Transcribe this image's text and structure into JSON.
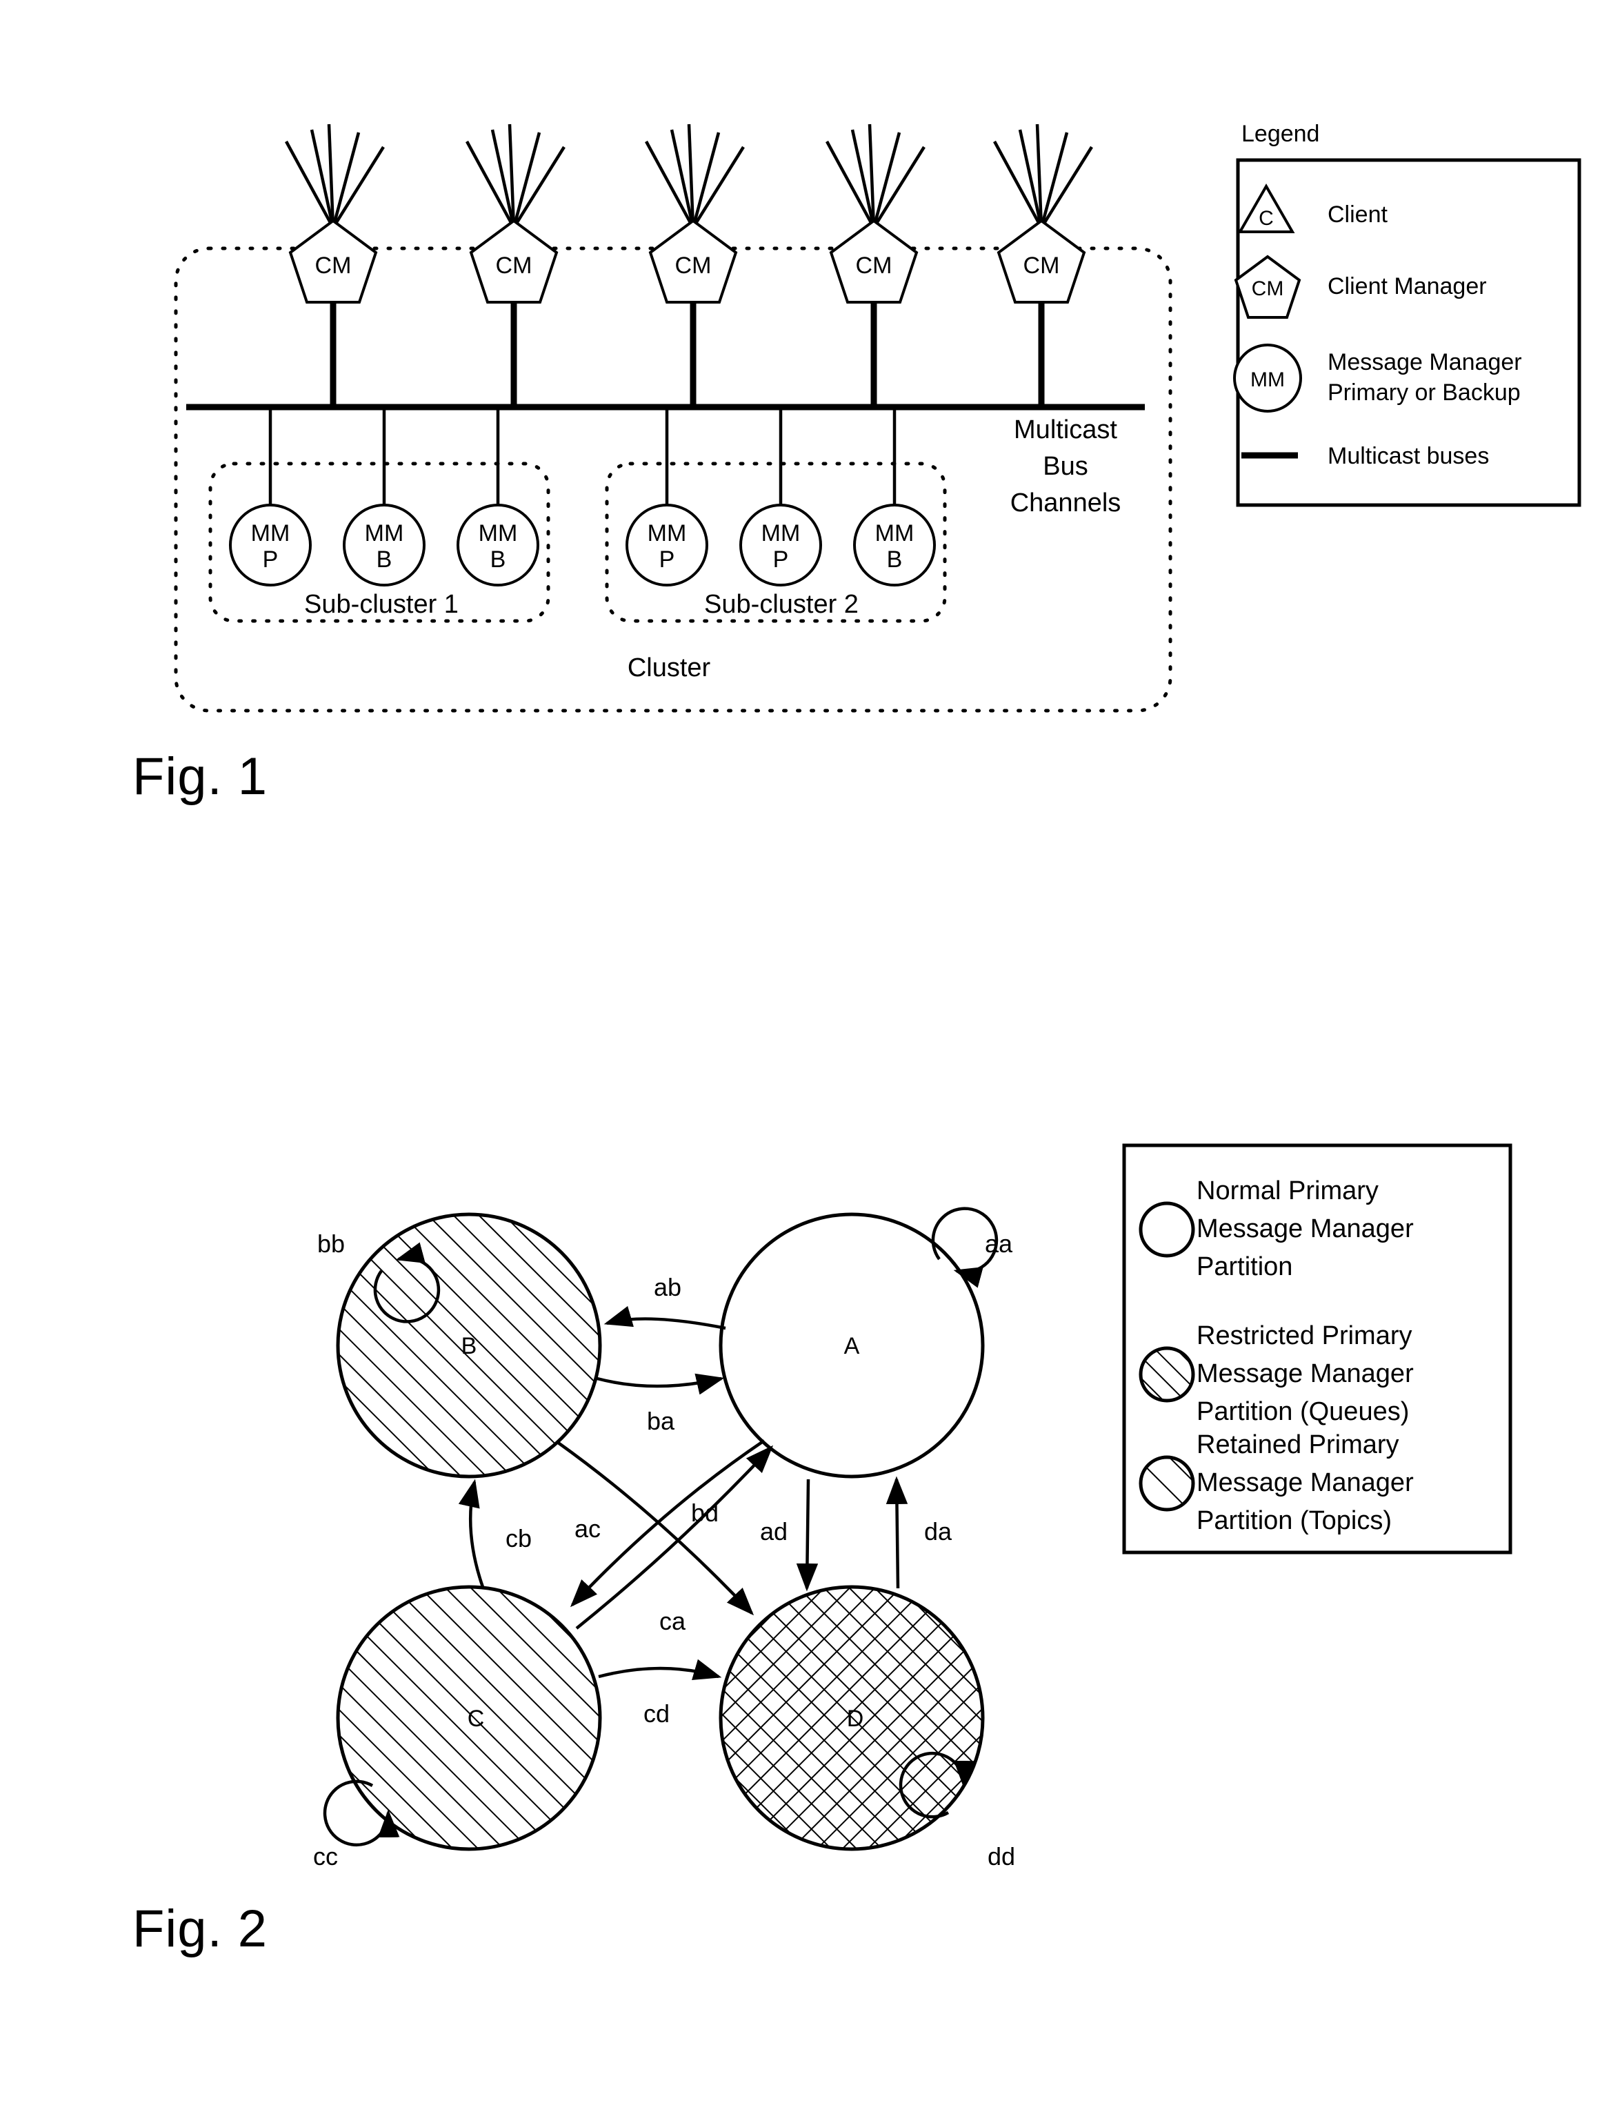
{
  "figure1": {
    "caption": "Fig. 1",
    "client_managers": [
      {
        "label": "CM"
      },
      {
        "label": "CM"
      },
      {
        "label": "CM"
      },
      {
        "label": "CM"
      },
      {
        "label": "CM"
      }
    ],
    "bus_label": [
      "Multicast",
      "Bus",
      "Channels"
    ],
    "cluster_label": "Cluster",
    "subclusters": [
      {
        "label": "Sub-cluster 1",
        "message_managers": [
          {
            "top": "MM",
            "bottom": "P"
          },
          {
            "top": "MM",
            "bottom": "B"
          },
          {
            "top": "MM",
            "bottom": "B"
          }
        ]
      },
      {
        "label": "Sub-cluster 2",
        "message_managers": [
          {
            "top": "MM",
            "bottom": "P"
          },
          {
            "top": "MM",
            "bottom": "P"
          },
          {
            "top": "MM",
            "bottom": "B"
          }
        ]
      }
    ],
    "legend": {
      "title": "Legend",
      "entries": [
        {
          "icon": "triangle",
          "icon_label": "C",
          "text": [
            "Client"
          ]
        },
        {
          "icon": "pentagon",
          "icon_label": "CM",
          "text": [
            "Client Manager"
          ]
        },
        {
          "icon": "circle",
          "icon_label": "MM",
          "text": [
            "Message Manager",
            "Primary or Backup"
          ]
        },
        {
          "icon": "line",
          "icon_label": "",
          "text": [
            "Multicast buses"
          ]
        }
      ]
    }
  },
  "figure2": {
    "caption": "Fig. 2",
    "nodes": [
      {
        "id": "A",
        "label": "A",
        "fill": "normal"
      },
      {
        "id": "B",
        "label": "B",
        "fill": "hatched"
      },
      {
        "id": "C",
        "label": "C",
        "fill": "hatched"
      },
      {
        "id": "D",
        "label": "D",
        "fill": "crosshatched"
      }
    ],
    "self_loops": [
      {
        "label": "aa",
        "node": "A"
      },
      {
        "label": "bb",
        "node": "B"
      },
      {
        "label": "cc",
        "node": "C"
      },
      {
        "label": "dd",
        "node": "D"
      }
    ],
    "transitions": [
      {
        "label": "ab",
        "from": "A",
        "to": "B"
      },
      {
        "label": "ba",
        "from": "B",
        "to": "A"
      },
      {
        "label": "cb",
        "from": "C",
        "to": "B"
      },
      {
        "label": "ac",
        "from": "A",
        "to": "C"
      },
      {
        "label": "bd",
        "from": "B",
        "to": "D"
      },
      {
        "label": "ca",
        "from": "C",
        "to": "A"
      },
      {
        "label": "ad",
        "from": "A",
        "to": "D"
      },
      {
        "label": "da",
        "from": "D",
        "to": "A"
      },
      {
        "label": "cd",
        "from": "C",
        "to": "D"
      }
    ],
    "legend": {
      "entries": [
        {
          "icon": "circle-plain",
          "text": [
            "Normal Primary",
            "Message Manager",
            "Partition"
          ]
        },
        {
          "icon": "circle-hatch",
          "text": [
            "Restricted Primary",
            "Message Manager",
            "Partition (Queues)"
          ]
        },
        {
          "icon": "circle-retain",
          "text": [
            "Retained Primary",
            "Message Manager",
            "Partition (Topics)"
          ]
        }
      ]
    }
  }
}
